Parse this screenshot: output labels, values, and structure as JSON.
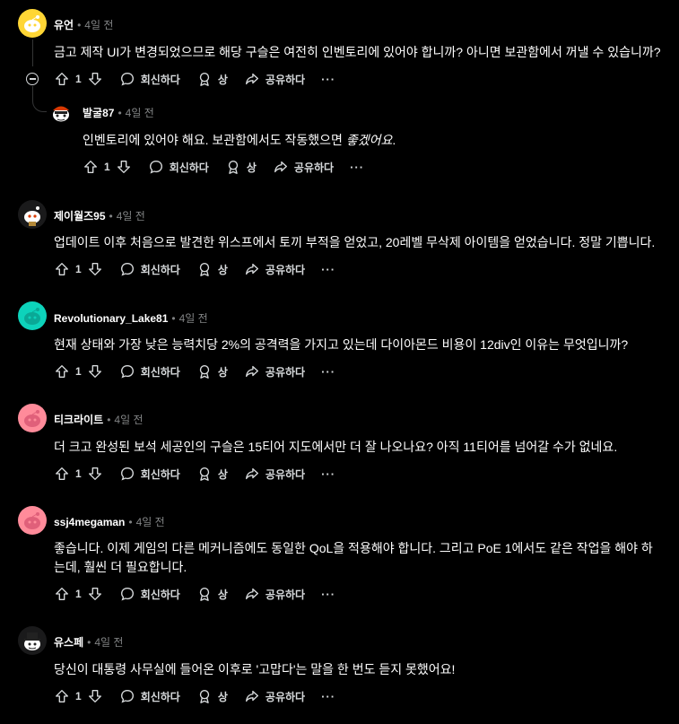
{
  "labels": {
    "reply": "회신하다",
    "award": "상",
    "share": "공유하다",
    "more": "···",
    "dot": "•"
  },
  "comments": [
    {
      "author": "유언",
      "time": "4일 전",
      "text": "금고 제작 UI가 변경되었으므로 해당 구슬은 여전히 인벤토리에 있어야 합니까? 아니면 보관함에서 꺼낼 수 있습니까?",
      "votes": "1",
      "avatar_color": "#ffd635"
    },
    {
      "author": "발굴87",
      "time": "4일 전",
      "text_main": "인벤토리에 있어야 해요. 보관함에서도 작동했으면 ",
      "text_em": "좋겠어요",
      "text_end": ".",
      "votes": "1",
      "avatar_color": "#000000"
    },
    {
      "author": "제이월즈95",
      "time": "4일 전",
      "text": "업데이트 이후 처음으로 발견한 위스프에서 토끼 부적을 얻었고, 20레벨 무삭제 아이템을 얻었습니다. 정말 기쁩니다.",
      "votes": "1",
      "avatar_color": "#1a1a1b"
    },
    {
      "author": "Revolutionary_Lake81",
      "time": "4일 전",
      "text": "현재 상태와 가장 낮은 능력치당 2%의 공격력을 가지고 있는데 다이아몬드 비용이 12div인 이유는 무엇입니까?",
      "votes": "1",
      "avatar_color": "#0dd3bb"
    },
    {
      "author": "티크라이트",
      "time": "4일 전",
      "text": "더 크고 완성된 보석 세공인의 구슬은 15티어 지도에서만 더 잘 나오나요? 아직 11티어를 넘어갈 수가 없네요.",
      "votes": "1",
      "avatar_color": "#ff8b9a"
    },
    {
      "author": "ssj4megaman",
      "time": "4일 전",
      "text": "좋습니다. 이제 게임의 다른 메커니즘에도 동일한 QoL을 적용해야 합니다. 그리고 PoE 1에서도 같은 작업을 해야 하는데, 훨씬 더 필요합니다.",
      "votes": "1",
      "avatar_color": "#ff8b9a"
    },
    {
      "author": "유스페",
      "time": "4일 전",
      "text": "당신이 대통령 사무실에 들어온 이후로 '고맙다'는 말을 한 번도 듣지 못했어요!",
      "votes": "1",
      "avatar_color": "#1a1a1b"
    }
  ]
}
